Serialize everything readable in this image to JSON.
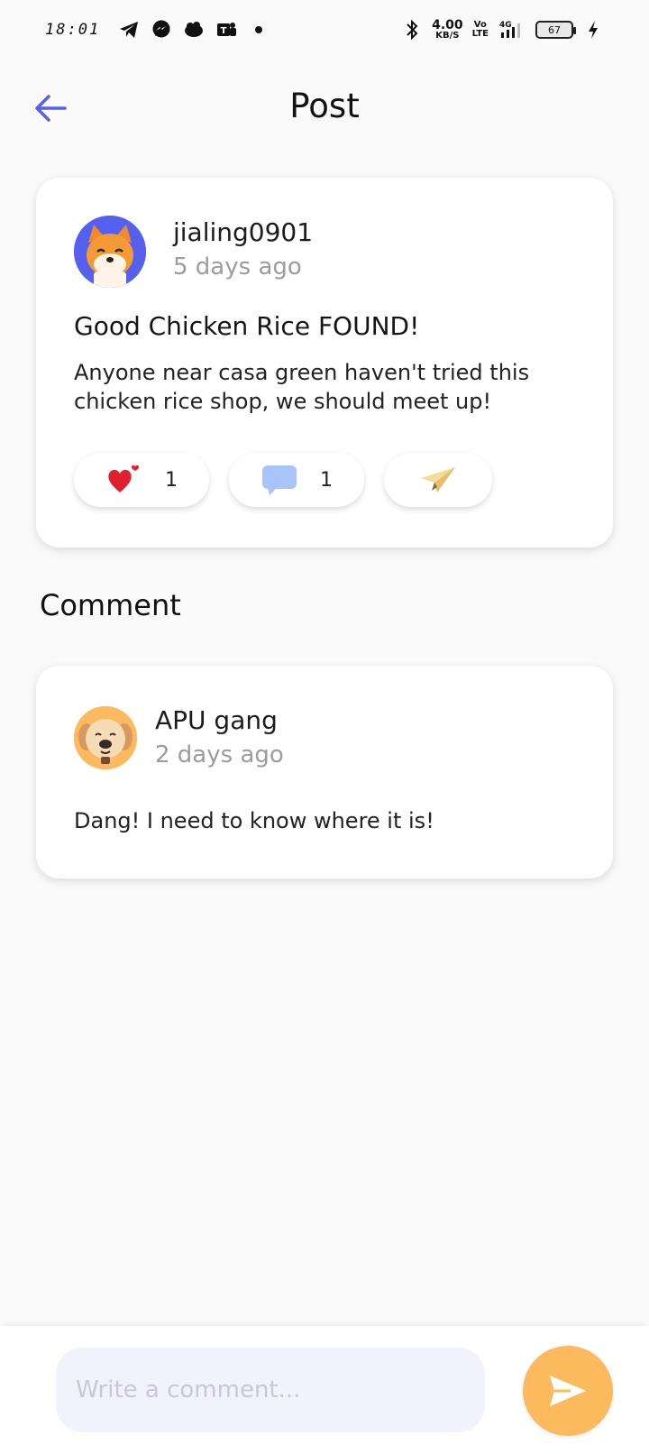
{
  "status_bar": {
    "time": "18:01",
    "net_speed_value": "4.00",
    "net_speed_unit": "KB/S",
    "volte_top": "Vo",
    "volte_bottom": "LTE",
    "network": "4G",
    "battery": "67"
  },
  "header": {
    "title": "Post"
  },
  "post": {
    "username": "jialing0901",
    "time_ago": "5 days ago",
    "title": "Good Chicken Rice FOUND!",
    "body": "Anyone near casa green haven't tried this chicken rice shop, we should meet up!",
    "like_count": "1",
    "comment_count": "1"
  },
  "comments_section": {
    "title": "Comment",
    "items": [
      {
        "username": "APU gang",
        "time_ago": "2 days ago",
        "text": "Dang! I need to know where it is!"
      }
    ]
  },
  "composer": {
    "placeholder": "Write a comment..."
  },
  "colors": {
    "accent": "#5660ee",
    "send_button": "#fdb95d",
    "input_bg": "#f2f2fd"
  }
}
